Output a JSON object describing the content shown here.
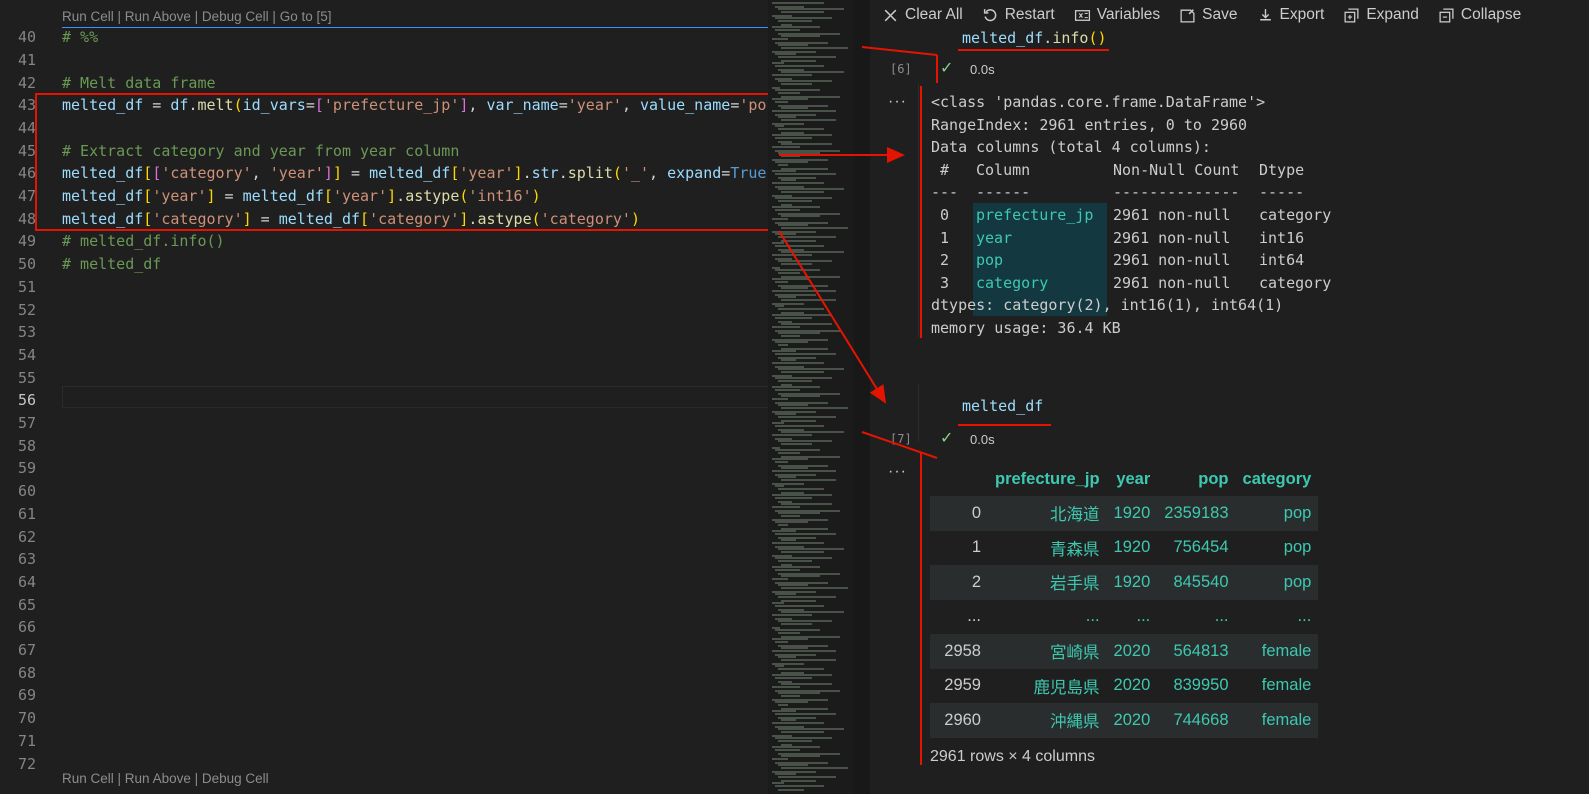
{
  "editor": {
    "codelens_top": {
      "run_cell": "Run Cell",
      "run_above": "Run Above",
      "debug_cell": "Debug Cell",
      "goto": "Go to [5]"
    },
    "codelens_bottom": {
      "run_cell": "Run Cell",
      "run_above": "Run Above",
      "debug_cell": "Debug Cell"
    },
    "separator": " | ",
    "line_numbers": [
      "40",
      "41",
      "42",
      "43",
      "44",
      "45",
      "46",
      "47",
      "48",
      "49",
      "50",
      "51",
      "52",
      "53",
      "54",
      "55",
      "56",
      "57",
      "58",
      "59",
      "60",
      "61",
      "62",
      "63",
      "64",
      "65",
      "66",
      "67",
      "68",
      "69",
      "70",
      "71",
      "72"
    ],
    "active_line": "56",
    "lines": {
      "l40": "# %%",
      "l42": "# Melt data frame",
      "l45": "# Extract category and year from year column",
      "l49": "# melted_df.info()",
      "l50": "# melted_df"
    },
    "l43": {
      "a": "melted_df",
      "b": " = ",
      "c": "df",
      "d": ".",
      "e": "melt",
      "f": "(",
      "g": "id_vars",
      "h": "=",
      "i": "[",
      "j": "'prefecture_jp'",
      "k": "]",
      "l": ", ",
      "m": "var_name",
      "n": "=",
      "o": "'year'",
      "p": ", ",
      "q": "value_name",
      "r": "=",
      "s": "'po"
    },
    "l46": {
      "a": "melted_df",
      "b": "[",
      "c": "[",
      "d": "'category'",
      "e": ", ",
      "f": "'year'",
      "g": "]",
      "h": "]",
      "i": " = ",
      "j": "melted_df",
      "k": "[",
      "l": "'year'",
      "m": "]",
      "n": ".",
      "o": "str",
      "p": ".",
      "q": "split",
      "r": "(",
      "s": "'_'",
      "t": ", ",
      "u": "expand",
      "v": "=",
      "w": "True"
    },
    "l47": {
      "a": "melted_df",
      "b": "[",
      "c": "'year'",
      "d": "]",
      "e": " = ",
      "f": "melted_df",
      "g": "[",
      "h": "'year'",
      "i": "]",
      "j": ".",
      "k": "astype",
      "l": "(",
      "m": "'int16'",
      "n": ")"
    },
    "l48": {
      "a": "melted_df",
      "b": "[",
      "c": "'category'",
      "d": "]",
      "e": " = ",
      "f": "melted_df",
      "g": "[",
      "h": "'category'",
      "i": "]",
      "j": ".",
      "k": "astype",
      "l": "(",
      "m": "'category'",
      "n": ")"
    }
  },
  "toolbar": {
    "clear_all": "Clear All",
    "restart": "Restart",
    "variables": "Variables",
    "save": "Save",
    "export": "Export",
    "expand": "Expand",
    "collapse": "Collapse"
  },
  "cell6": {
    "code_var": "melted_df",
    "code_dot": ".",
    "code_fn": "info",
    "code_paren": "()",
    "exec": "[6]",
    "check": "✓",
    "time": "0.0s",
    "more": "···",
    "output": {
      "line1": "<class 'pandas.core.frame.DataFrame'>",
      "line2": "RangeIndex: 2961 entries, 0 to 2960",
      "line3": "Data columns (total 4 columns):",
      "header": {
        "num": " #",
        "col": "Column",
        "nn": "Non-Null Count",
        "dtype": "Dtype"
      },
      "dashes": {
        "num": "---",
        "col": "------",
        "nn": "--------------",
        "dtype": "-----"
      },
      "rows": [
        {
          "i": "0",
          "name": "prefecture_jp",
          "nn": "2961 non-null",
          "dtype": "category"
        },
        {
          "i": "1",
          "name": "year",
          "nn": "2961 non-null",
          "dtype": "int16"
        },
        {
          "i": "2",
          "name": "pop",
          "nn": "2961 non-null",
          "dtype": "int64"
        },
        {
          "i": "3",
          "name": "category",
          "nn": "2961 non-null",
          "dtype": "category"
        }
      ],
      "dtypes": "dtypes: category(2), int16(1), int64(1)",
      "memory": "memory usage: 36.4 KB"
    }
  },
  "cell7": {
    "code": "melted_df",
    "exec": "[7]",
    "check": "✓",
    "time": "0.0s",
    "more": "···",
    "table": {
      "headers": [
        "",
        "prefecture_jp",
        "year",
        "pop",
        "category"
      ],
      "rows": [
        [
          "0",
          "北海道",
          "1920",
          "2359183",
          "pop"
        ],
        [
          "1",
          "青森県",
          "1920",
          "756454",
          "pop"
        ],
        [
          "2",
          "岩手県",
          "1920",
          "845540",
          "pop"
        ],
        [
          "...",
          "...",
          "...",
          "...",
          "..."
        ],
        [
          "2958",
          "宮崎県",
          "2020",
          "564813",
          "female"
        ],
        [
          "2959",
          "鹿児島県",
          "2020",
          "839950",
          "female"
        ],
        [
          "2960",
          "沖縄県",
          "2020",
          "744668",
          "female"
        ]
      ]
    },
    "footer": "2961 rows × 4 columns"
  }
}
